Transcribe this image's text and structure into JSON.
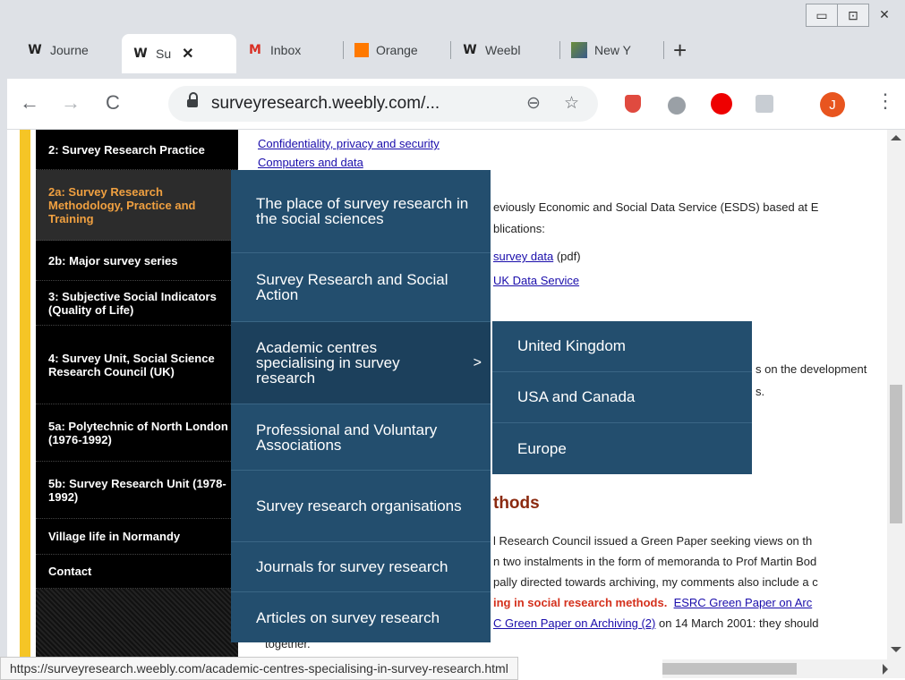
{
  "window": {
    "minimize": "▭",
    "maximize": "⊡",
    "close": "✕"
  },
  "tabs": [
    {
      "icon": "weebly-icon",
      "label": "Journe",
      "fav": "W"
    },
    {
      "icon": "weebly-icon",
      "label": "Su",
      "fav": "W",
      "active": true
    },
    {
      "icon": "gmail-icon",
      "label": "Inbox",
      "fav": "M"
    },
    {
      "icon": "orange-icon",
      "label": "Orange",
      "fav": ""
    },
    {
      "icon": "weebly-icon",
      "label": "Weebl",
      "fav": "W"
    },
    {
      "icon": "new-york-icon",
      "label": "New Y",
      "fav": ""
    }
  ],
  "new_tab": "+",
  "toolbar": {
    "back": "←",
    "forward": "→",
    "reload": "C",
    "url": "surveyresearch.weebly.com/...",
    "zoom_icon": "search-icon",
    "star_icon": "star-icon",
    "avatar_letter": "J",
    "menu": "⋮"
  },
  "sidebar": {
    "items": [
      {
        "label": "2: Survey Research Practice"
      },
      {
        "label": "2a: Survey Research Methodology, Practice and Training",
        "active": true
      },
      {
        "label": "2b: Major survey series"
      },
      {
        "label": "3: Subjective Social Indicators (Quality of Life)"
      },
      {
        "label": "4: Survey Unit, Social Science Research Council (UK)"
      },
      {
        "label": "5a: Polytechnic of North London (1976-1992)"
      },
      {
        "label": "5b: Survey Research Unit (1978-1992)"
      },
      {
        "label": "Village life in Normandy"
      },
      {
        "label": "Contact"
      }
    ]
  },
  "content": {
    "link1": "Confidentiality, privacy and security",
    "link2": "Computers and data",
    "text1": "eviously Economic and Social Data Service (ESDS) based at E",
    "text2": "blications:",
    "link3": "survey data",
    "text3": " (pdf)",
    "link4": "UK Data Service",
    "text4": "s on the development",
    "text5": "s.",
    "heading": "thods",
    "p1": "l Research Council issued a Green Paper seeking views on th",
    "p2": "n two instalments in the form of memoranda to Prof Martin Bod",
    "p3": "pally directed towards archiving, my comments also include a c",
    "p4_bold": "ing in social research methods.",
    "p4_link": "ESRC Green Paper on Arc",
    "p5_link": "C Green Paper on Archiving (2)",
    "p5_text": " on 14 March 2001: they should",
    "p6": "together."
  },
  "dropdown": {
    "items": [
      {
        "label": "The place of survey research in the social sciences"
      },
      {
        "label": "Survey Research and Social Action"
      },
      {
        "label": "Academic centres specialising in survey research",
        "arrow": ">"
      },
      {
        "label": "Professional and Voluntary Associations"
      },
      {
        "label": "Survey research organisations"
      },
      {
        "label": "Journals for survey research"
      },
      {
        "label": "Articles on survey research"
      }
    ]
  },
  "submenu": {
    "items": [
      {
        "label": "United Kingdom"
      },
      {
        "label": "USA and Canada"
      },
      {
        "label": "Europe"
      }
    ]
  },
  "status_url": "https://surveyresearch.weebly.com/academic-centres-specialising-in-survey-research.html",
  "colors": {
    "menu_bg": "#234e6e",
    "active_sidebar_text": "#f0a040",
    "accent_bar": "#f5c526",
    "avatar": "#e8551f"
  }
}
